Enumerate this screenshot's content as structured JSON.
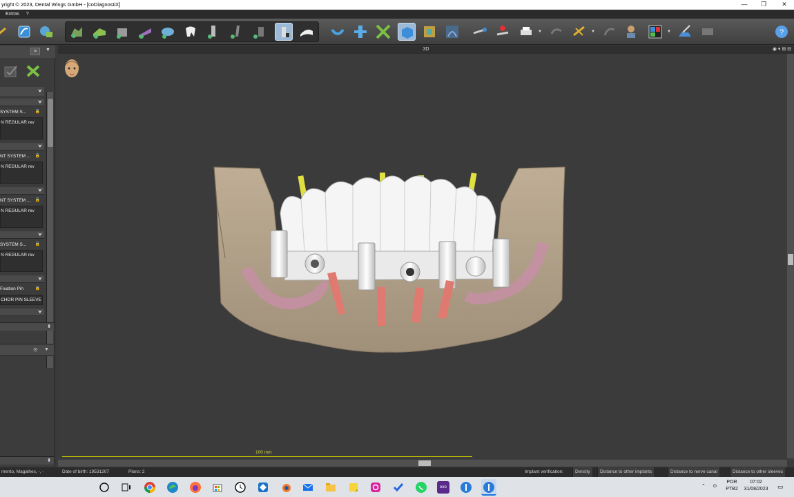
{
  "window": {
    "title": "yright © 2023, Dental Wings GmbH - [coDiagnostiX]",
    "controls": [
      "—",
      "❐",
      "✕"
    ]
  },
  "menubar": {
    "items": [
      "Extras",
      "?"
    ]
  },
  "left_panel": {
    "rows": [
      {
        "label": "SYSTEM S...",
        "value": "N REGULAR rev"
      },
      {
        "label": "NT SYSTEM ...",
        "value": "N REGULAR rev"
      },
      {
        "label": "NT SYSTEM ...",
        "value": "N REGULAR rev"
      },
      {
        "label": "SYSTEM S...",
        "value": "N REGULAR rev"
      },
      {
        "label": "Fixation Pin",
        "value": "CHOR PIN SLEEVE"
      }
    ]
  },
  "viewport": {
    "title": "3D",
    "scale_label": "100 mm"
  },
  "statusbar": {
    "patient": "mento, Magalhes, -, -",
    "dob": "Date of birth: 19531207",
    "plans": "Plans: 2",
    "implant_verification": "Implant verification:",
    "buttons": [
      "Density",
      "Distance to other implants",
      "Distance to nerve canal",
      "Distance to other sleeves"
    ]
  },
  "taskbar": {
    "lang1": "POR",
    "lang2": "PTB2",
    "time": "07:02",
    "date": "31/08/2023",
    "exo_label": "exo"
  }
}
